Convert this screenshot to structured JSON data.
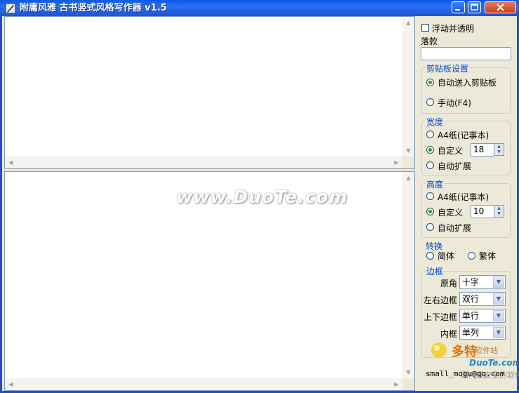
{
  "window": {
    "title": "附庸风雅 古书竖式风格写作器 v1.5"
  },
  "panel": {
    "float_transparent": "浮动并透明",
    "inscription_label": "落款",
    "inscription_value": "",
    "clipboard": {
      "title": "剪贴板设置",
      "auto": "自动送入剪贴板",
      "manual": "手动(F4)"
    },
    "width": {
      "title": "宽度",
      "a4": "A4纸(记事本)",
      "custom": "自定义",
      "custom_value": "18",
      "auto": "自动扩展"
    },
    "height": {
      "title": "高度",
      "a4": "A4纸(记事本)",
      "custom": "自定义",
      "custom_value": "10",
      "auto": "自动扩展"
    },
    "convert": {
      "title": "转换",
      "simplified": "简体",
      "traditional": "繁体"
    },
    "border": {
      "title": "边框",
      "corner_label": "原角",
      "corner_value": "十字",
      "lr_label": "左右边框",
      "lr_value": "双行",
      "tb_label": "上下边框",
      "tb_value": "单行",
      "inner_label": "内框",
      "inner_value": "单列"
    },
    "email": "small_mogu@qq.com"
  },
  "watermark": "www.DuoTe.com",
  "logo": {
    "name": "多特",
    "sub": "软件站",
    "domain": "DuoTe.com",
    "slogan": "国内最安全的软件站"
  }
}
